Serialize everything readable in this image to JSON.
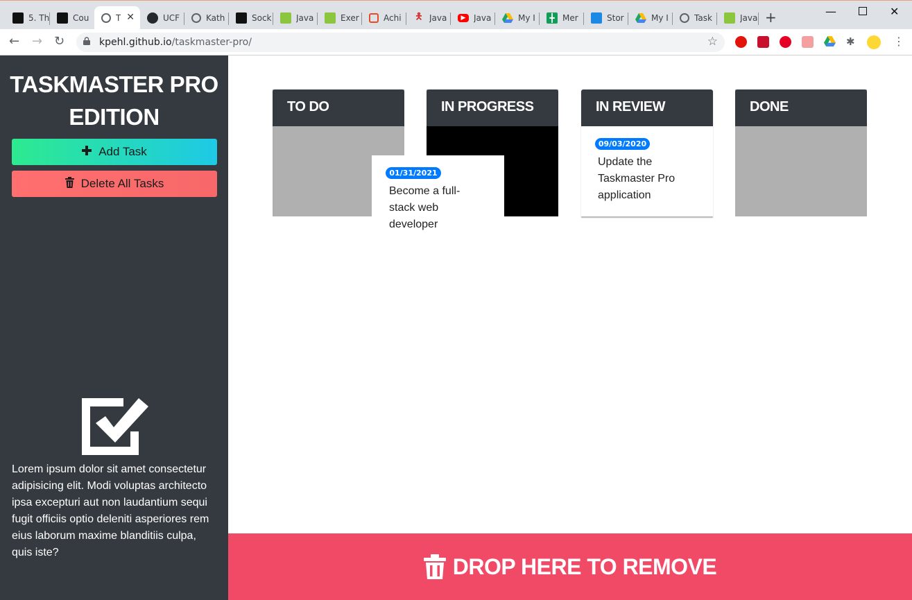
{
  "browser": {
    "tabs": [
      {
        "title": "5. Th",
        "favicon_color": "#111111",
        "favicon": "ucf-icon"
      },
      {
        "title": "Cou",
        "favicon_color": "#111111",
        "favicon": "ucf-icon"
      },
      {
        "title": "T",
        "favicon_color": "#5f6368",
        "favicon": "globe-icon",
        "active": true
      },
      {
        "title": "UCF",
        "favicon_color": "#24292e",
        "favicon": "github-icon"
      },
      {
        "title": "Kath",
        "favicon_color": "#5f6368",
        "favicon": "globe-icon"
      },
      {
        "title": "Sock",
        "favicon_color": "#111111",
        "favicon": "ni-icon"
      },
      {
        "title": "Java",
        "favicon_color": "#8cc63f",
        "favicon": "w3-icon"
      },
      {
        "title": "Exer",
        "favicon_color": "#8cc63f",
        "favicon": "w3-icon"
      },
      {
        "title": "Achi",
        "favicon_color": "#e34c26",
        "favicon": "web-icon"
      },
      {
        "title": "Java",
        "favicon_color": "#d32f2f",
        "favicon": "figure-icon"
      },
      {
        "title": "Java",
        "favicon_color": "#ff0000",
        "favicon": "youtube-icon"
      },
      {
        "title": "My I",
        "favicon_color": "#1fa463",
        "favicon": "drive-icon"
      },
      {
        "title": "Mer",
        "favicon_color": "#0f9d58",
        "favicon": "sheets-icon"
      },
      {
        "title": "Stor",
        "favicon_color": "#1e88e5",
        "favicon": "storage-icon"
      },
      {
        "title": "My I",
        "favicon_color": "#1fa463",
        "favicon": "drive-icon"
      },
      {
        "title": "Task",
        "favicon_color": "#5f6368",
        "favicon": "globe-icon"
      },
      {
        "title": "Java",
        "favicon_color": "#8cc63f",
        "favicon": "w3-icon"
      }
    ],
    "url_host": "kpehl.github.io",
    "url_path": "/taskmaster-pro/"
  },
  "app": {
    "title_line1": "TASKMASTER PRO",
    "title_line2": "EDITION",
    "add_task_label": "Add Task",
    "delete_all_label": "Delete All Tasks",
    "description": "Lorem ipsum dolor sit amet consectetur adipisicing elit. Modi voluptas architecto ipsa excepturi aut non laudantium sequi fugit officiis optio deleniti asperiores rem eius laborum maxime blanditiis culpa, quis iste?",
    "drop_label": "DROP HERE TO REMOVE"
  },
  "lanes": [
    {
      "title": "TO DO"
    },
    {
      "title": "IN PROGRESS"
    },
    {
      "title": "IN REVIEW"
    },
    {
      "title": "DONE"
    }
  ],
  "tasks": [
    {
      "date": "01/31/2021",
      "text": "Become a full-stack web developer",
      "lane": "IN PROGRESS",
      "dragging": true
    },
    {
      "date": "09/03/2020",
      "text": "Update the Taskmaster Pro application",
      "lane": "IN REVIEW"
    }
  ],
  "colors": {
    "sidebar_bg": "#343a40",
    "drop_zone": "#f04a66",
    "badge": "#007bff",
    "lane_empty": "#b0b0b0"
  }
}
